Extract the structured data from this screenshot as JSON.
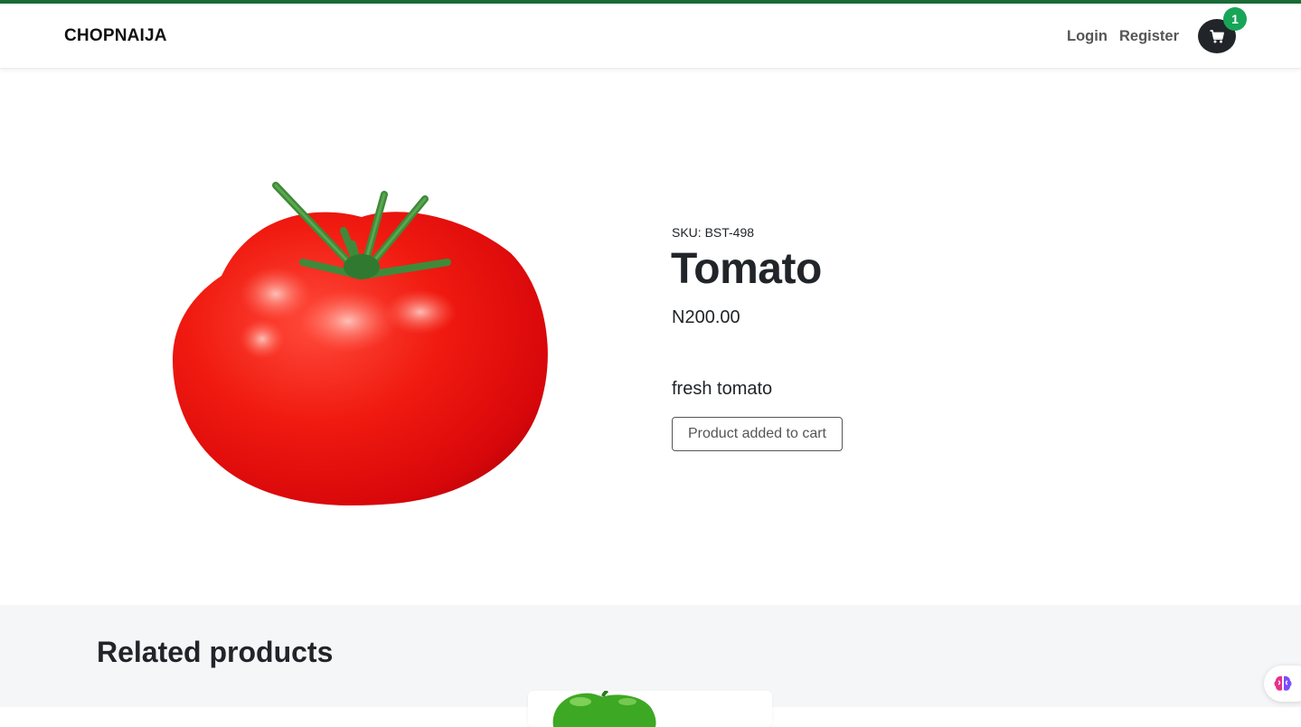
{
  "colors": {
    "accent": "#1a6b38",
    "badge": "#18a558",
    "cart_button": "#212529",
    "tomato": "#e8100c"
  },
  "header": {
    "brand": "CHOPNAIJA",
    "nav": {
      "login": "Login",
      "register": "Register"
    },
    "cart": {
      "icon": "cart-icon",
      "count": "1"
    }
  },
  "product": {
    "image_icon": "tomato-image",
    "sku": "SKU: BST-498",
    "name": "Tomato",
    "price": "N200.00",
    "description": "fresh tomato",
    "cart_status": "Product added to cart"
  },
  "related": {
    "title": "Related products",
    "items": [
      {
        "image_icon": "green-pepper-image"
      }
    ]
  },
  "floating_widget": {
    "icon": "brain-icon"
  }
}
